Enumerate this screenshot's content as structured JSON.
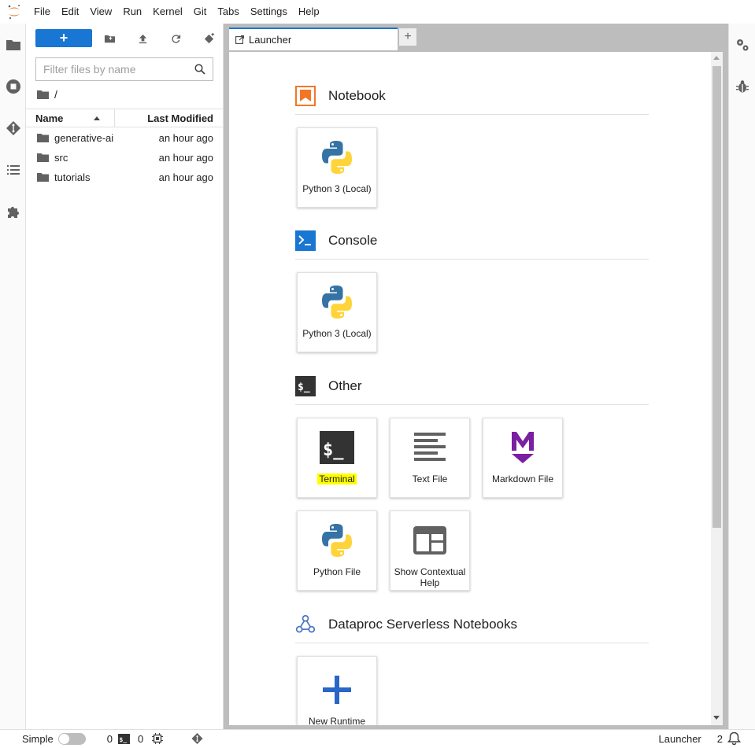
{
  "menubar": {
    "items": [
      "File",
      "Edit",
      "View",
      "Run",
      "Kernel",
      "Git",
      "Tabs",
      "Settings",
      "Help"
    ]
  },
  "filebrowser": {
    "new_button_label": "+",
    "search": {
      "placeholder": "Filter files by name",
      "value": ""
    },
    "breadcrumb": "/",
    "columns": {
      "name": "Name",
      "modified": "Last Modified"
    },
    "files": [
      {
        "name": "generative-ai",
        "modified": "an hour ago"
      },
      {
        "name": "src",
        "modified": "an hour ago"
      },
      {
        "name": "tutorials",
        "modified": "an hour ago"
      }
    ]
  },
  "tabs": {
    "launcher_label": "Launcher",
    "add_label": "+"
  },
  "launcher": {
    "sections": {
      "notebook": "Notebook",
      "console": "Console",
      "other": "Other",
      "dataproc": "Dataproc Serverless Notebooks"
    },
    "cards": {
      "notebook_python": "Python 3 (Local)",
      "console_python": "Python 3 (Local)",
      "terminal": "Terminal",
      "text_file": "Text File",
      "markdown_file": "Markdown File",
      "python_file": "Python File",
      "contextual_help": "Show Contextual Help",
      "new_runtime": "New Runtime Template"
    }
  },
  "statusbar": {
    "simple_label": "Simple",
    "kernels_count": "0",
    "terminals_count": "0",
    "mode_label": "Launcher",
    "notification_count": "2"
  },
  "colors": {
    "accent": "#1976d2",
    "notebook_orange": "#f37626",
    "console_blue": "#1976d2",
    "markdown_purple": "#7b1fa2",
    "highlight": "#ffff00"
  }
}
